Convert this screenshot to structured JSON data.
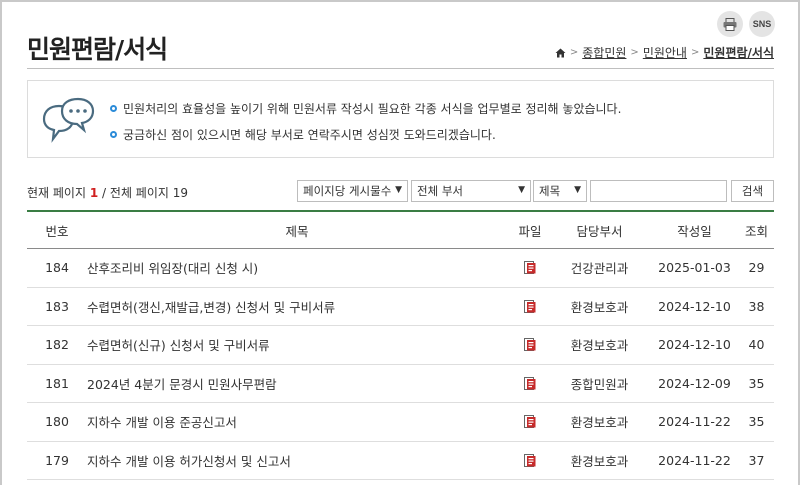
{
  "top_buttons": {
    "sns_label": "SNS"
  },
  "page_title": "민원편람/서식",
  "breadcrumb": [
    "종합민원",
    "민원안내",
    "민원편람/서식"
  ],
  "notice": {
    "line1": "민원처리의 효율성을 높이기 위해 민원서류 작성시 필요한 각종 서식을 업무별로 정리해 놓았습니다.",
    "line2": "궁금하신 점이 있으시면 해당 부서로 연락주시면 성심껏 도와드리겠습니다."
  },
  "page_info": {
    "prefix": "현재 페이지",
    "current": "1",
    "separator": "/",
    "total_label": "전체 페이지 19"
  },
  "search": {
    "per_page": "페이지당 게시물수",
    "department": "전체 부서",
    "field": "제목",
    "query": "",
    "button": "검색"
  },
  "table": {
    "headers": {
      "no": "번호",
      "title": "제목",
      "file": "파일",
      "dept": "담당부서",
      "date": "작성일",
      "views": "조회"
    },
    "rows": [
      {
        "no": "184",
        "title": "산후조리비 위임장(대리 신청 시)",
        "dept": "건강관리과",
        "date": "2025-01-03",
        "views": "29"
      },
      {
        "no": "183",
        "title": "수렵면허(갱신,재발급,변경) 신청서 및 구비서류",
        "dept": "환경보호과",
        "date": "2024-12-10",
        "views": "38"
      },
      {
        "no": "182",
        "title": "수렵면허(신규) 신청서 및 구비서류",
        "dept": "환경보호과",
        "date": "2024-12-10",
        "views": "40"
      },
      {
        "no": "181",
        "title": "2024년 4분기 문경시 민원사무편람",
        "dept": "종합민원과",
        "date": "2024-12-09",
        "views": "35"
      },
      {
        "no": "180",
        "title": "지하수 개발 이용 준공신고서",
        "dept": "환경보호과",
        "date": "2024-11-22",
        "views": "35"
      },
      {
        "no": "179",
        "title": "지하수 개발 이용 허가신청서 및 신고서",
        "dept": "환경보호과",
        "date": "2024-11-22",
        "views": "37"
      }
    ]
  },
  "colors": {
    "accent_green": "#3a7d44",
    "current_page_red": "#d02020",
    "bullet_blue": "#2b8bd8"
  }
}
